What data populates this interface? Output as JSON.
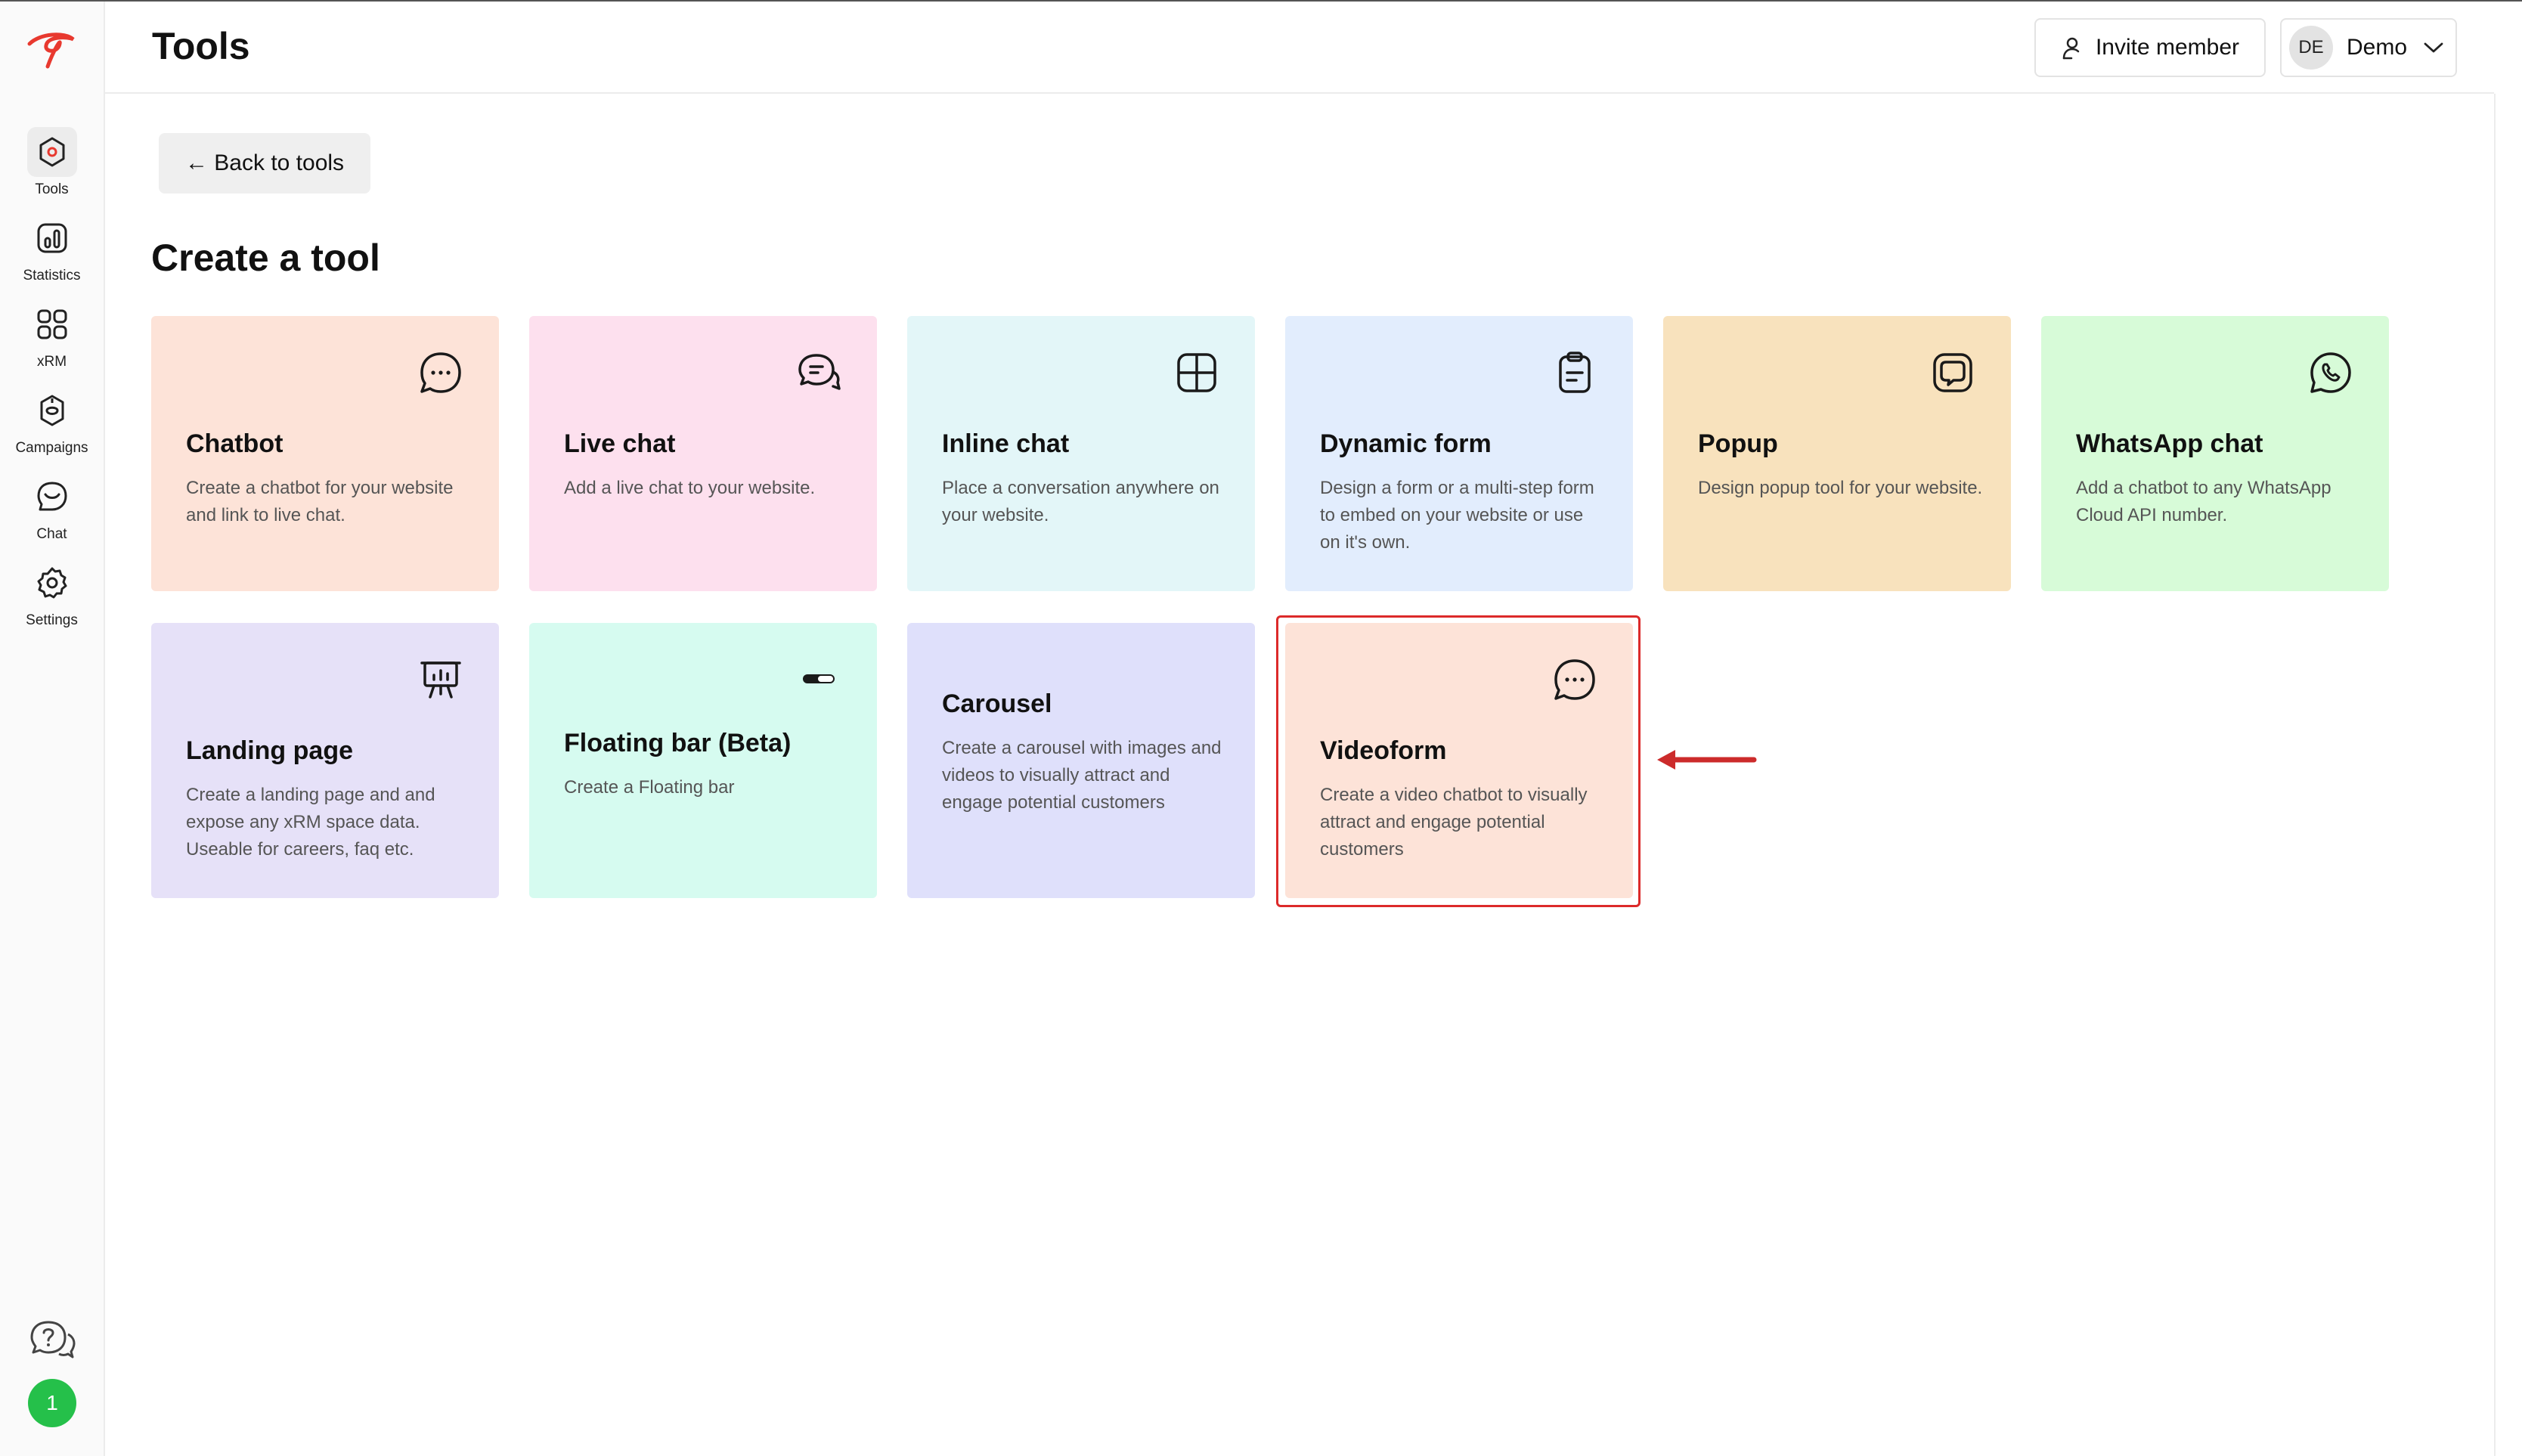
{
  "sidebar": {
    "items": [
      {
        "label": "Tools",
        "icon": "tools-icon",
        "active": true
      },
      {
        "label": "Statistics",
        "icon": "statistics-icon",
        "active": false
      },
      {
        "label": "xRM",
        "icon": "grid-icon",
        "active": false
      },
      {
        "label": "Campaigns",
        "icon": "campaigns-icon",
        "active": false
      },
      {
        "label": "Chat",
        "icon": "chat-icon",
        "active": false
      },
      {
        "label": "Settings",
        "icon": "gear-icon",
        "active": false
      }
    ],
    "help_icon": "help-chat-icon",
    "user_badge": "1"
  },
  "header": {
    "title": "Tools",
    "invite_label": "Invite member",
    "account_initials": "DE",
    "account_name": "Demo"
  },
  "main": {
    "back_label": "← Back to tools",
    "section_title": "Create a tool",
    "cards": [
      {
        "title": "Chatbot",
        "desc": "Create a chatbot for your website and link to live chat.",
        "icon": "chat-bubble-icon",
        "bg": "#fde3d8"
      },
      {
        "title": "Live chat",
        "desc": "Add a live chat to your website.",
        "icon": "live-chat-icon",
        "bg": "#fde0ee"
      },
      {
        "title": "Inline chat",
        "desc": "Place a conversation anywhere on your website.",
        "icon": "layout-icon",
        "bg": "#e3f6f8"
      },
      {
        "title": "Dynamic form",
        "desc": "Design a form or a multi-step form to embed on your website or use on it's own.",
        "icon": "clipboard-icon",
        "bg": "#e2edfd"
      },
      {
        "title": "Popup",
        "desc": "Design popup tool for your website.",
        "icon": "popup-icon",
        "bg": "#f8e2bd"
      },
      {
        "title": "WhatsApp chat",
        "desc": "Add a chatbot to any WhatsApp Cloud API number.",
        "icon": "whatsapp-icon",
        "bg": "#d7fbd8"
      },
      {
        "title": "Landing page",
        "desc": "Create a landing page and and expose any xRM space data. Useable for careers, faq etc.",
        "icon": "presentation-icon",
        "bg": "#e6e1f8"
      },
      {
        "title": "Floating bar (Beta)",
        "desc": "Create a Floating bar",
        "icon": "toggle-bar-icon",
        "bg": "#d6fbf0"
      },
      {
        "title": "Carousel",
        "desc": "Create a carousel with images and videos to visually attract and engage potential customers",
        "icon": "",
        "bg": "#dfe0fb"
      },
      {
        "title": "Videoform",
        "desc": "Create a video chatbot to visually attract and engage potential customers",
        "icon": "message-circle-icon",
        "bg": "#fde3d8"
      }
    ]
  },
  "colors": {
    "accent_red": "#dc2a2a",
    "logo_red": "#e8392f",
    "badge_green": "#25c04a"
  }
}
